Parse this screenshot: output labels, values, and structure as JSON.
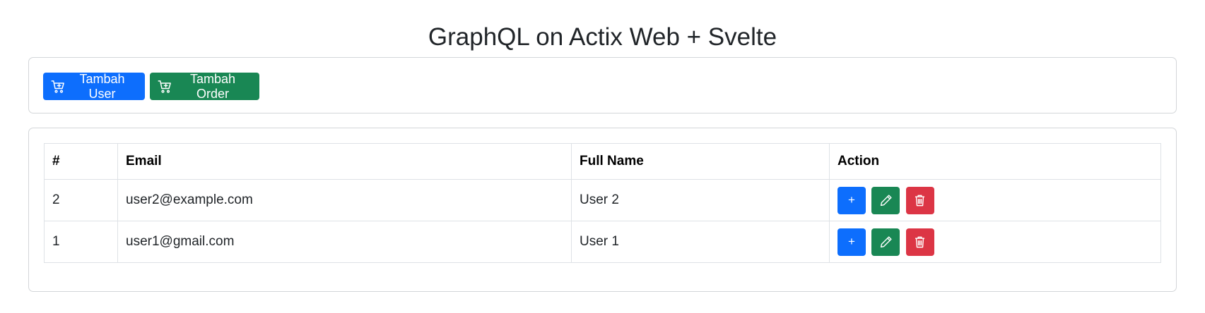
{
  "page": {
    "title": "GraphQL on Actix Web + Svelte"
  },
  "toolbar": {
    "add_user_label": "Tambah User",
    "add_order_label": "Tambah Order",
    "icon": "cart-plus-icon"
  },
  "table": {
    "headers": [
      "#",
      "Email",
      "Full Name",
      "Action"
    ],
    "rows": [
      {
        "id": "2",
        "email": "user2@example.com",
        "full_name": "User 2"
      },
      {
        "id": "1",
        "email": "user1@gmail.com",
        "full_name": "User 1"
      }
    ],
    "actions": {
      "add_label": "+",
      "edit_icon": "pencil-icon",
      "delete_icon": "trash-icon"
    }
  },
  "colors": {
    "primary": "#0d6efd",
    "success": "#198754",
    "danger": "#dc3545"
  }
}
